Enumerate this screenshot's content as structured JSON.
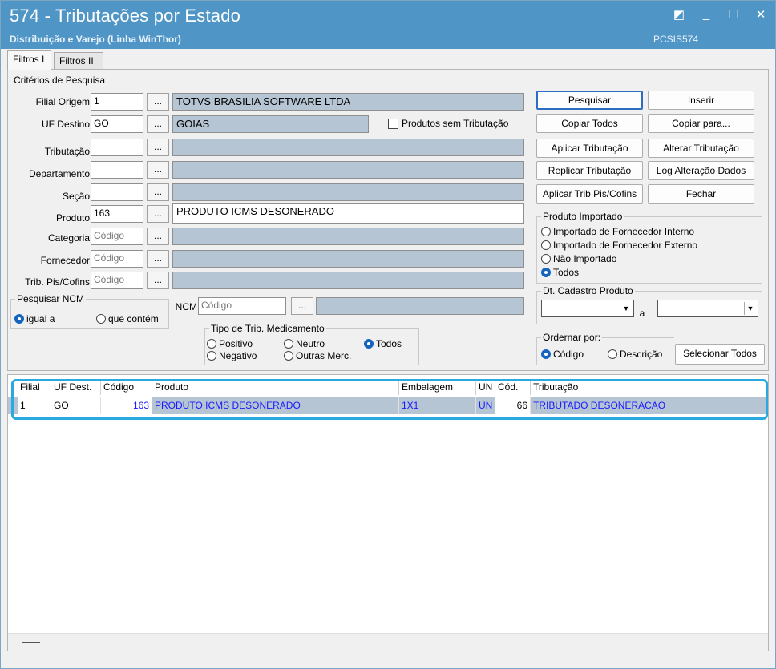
{
  "window": {
    "title": "574 - Tributações por Estado",
    "subtitle": "Distribuição e Varejo (Linha WinThor)",
    "code": "PCSIS574",
    "controls": [
      "◩",
      "_",
      "☐",
      "✕"
    ]
  },
  "tabs": [
    {
      "label": "Filtros I",
      "active": true
    },
    {
      "label": "Filtros II",
      "active": false
    }
  ],
  "criteria": {
    "group_title": "Critérios de Pesquisa",
    "filial_origem": {
      "label": "Filial Origem",
      "value": "1",
      "description": "TOTVS BRASILIA SOFTWARE LTDA"
    },
    "uf_destino": {
      "label": "UF Destino",
      "value": "GO",
      "description": "GOIAS"
    },
    "produtos_sem_trib": {
      "label": "Produtos sem Tributação",
      "checked": false
    },
    "tributacao": {
      "label": "Tributação",
      "value": "",
      "description": ""
    },
    "departamento": {
      "label": "Departamento",
      "value": "",
      "description": ""
    },
    "secao": {
      "label": "Seção",
      "value": "",
      "description": ""
    },
    "produto": {
      "label": "Produto",
      "value": "163",
      "description": "PRODUTO ICMS DESONERADO"
    },
    "categoria": {
      "label": "Categoria",
      "placeholder": "Código",
      "description": ""
    },
    "fornecedor": {
      "label": "Fornecedor",
      "placeholder": "Código",
      "description": ""
    },
    "trib_pis_cofins": {
      "label": "Trib. Pis/Cofins",
      "placeholder": "Código",
      "description": ""
    },
    "dots": "...",
    "ncm": {
      "label": "NCM",
      "placeholder": "Código"
    }
  },
  "pesquisar_ncm": {
    "title": "Pesquisar NCM",
    "options": [
      {
        "label": "igual a",
        "selected": true
      },
      {
        "label": "que contém",
        "selected": false
      }
    ]
  },
  "tipo_trib_medicamento": {
    "title": "Tipo de Trib. Medicamento",
    "options": [
      {
        "label": "Positivo",
        "selected": false
      },
      {
        "label": "Neutro",
        "selected": false
      },
      {
        "label": "Todos",
        "selected": true
      },
      {
        "label": "Negativo",
        "selected": false
      },
      {
        "label": "Outras Merc.",
        "selected": false
      }
    ]
  },
  "buttons": {
    "pesquisar": "Pesquisar",
    "inserir": "Inserir",
    "copiar_todos": "Copiar Todos",
    "copiar_para": "Copiar para...",
    "aplicar_tributacao": "Aplicar Tributação",
    "alterar_tributacao": "Alterar Tributação",
    "replicar_tributacao": "Replicar Tributação",
    "log_alteracao": "Log Alteração Dados",
    "aplicar_trib_pis": "Aplicar Trib Pis/Cofins",
    "fechar": "Fechar",
    "selecionar_todos": "Selecionar Todos"
  },
  "produto_importado": {
    "title": "Produto Importado",
    "options": [
      {
        "label": "Importado de Fornecedor Interno",
        "selected": false
      },
      {
        "label": "Importado de Fornecedor Externo",
        "selected": false
      },
      {
        "label": "Não Importado",
        "selected": false
      },
      {
        "label": "Todos",
        "selected": true
      }
    ]
  },
  "dt_cadastro": {
    "title": "Dt. Cadastro Produto",
    "separator": "a",
    "from": "",
    "to": ""
  },
  "ordenar": {
    "title": "Ordernar por:",
    "options": [
      {
        "label": "Código",
        "selected": true
      },
      {
        "label": "Descrição",
        "selected": false
      }
    ]
  },
  "grid": {
    "columns": [
      "Filial",
      "UF Dest.",
      "Código",
      "Produto",
      "Embalagem",
      "UN",
      "Cód.",
      "Tributação"
    ],
    "rows": [
      [
        "1",
        "GO",
        "163",
        "PRODUTO ICMS DESONERADO",
        "1X1",
        "UN",
        "66",
        "TRIBUTADO DESONERACAO"
      ]
    ]
  },
  "colors": {
    "titlebar": "#4f95c6",
    "readonly_field": "#b6c5d4",
    "highlight": "#29a9e0",
    "radio_selected": "#1565c0",
    "grid_text_blue": "#1a1aff"
  }
}
